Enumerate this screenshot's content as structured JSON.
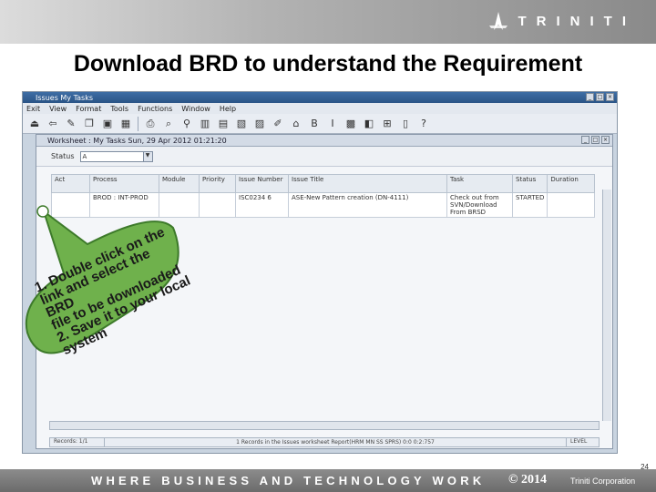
{
  "brand": {
    "logo_text": "TRINITI"
  },
  "slide_title": "Download BRD to understand the Requirement",
  "app": {
    "window_title": "Issues My Tasks",
    "menu": [
      "Exit",
      "View",
      "Format",
      "Tools",
      "Functions",
      "Window",
      "Help"
    ],
    "toolbar_icons": [
      "exit-icon",
      "back-icon",
      "edit-icon",
      "copy-icon",
      "save-icon",
      "save-all-icon",
      "print-icon",
      "find-icon",
      "filter-icon",
      "columns-icon",
      "grid-icon",
      "notes-icon",
      "chart-icon",
      "tools-icon",
      "attachment-icon",
      "bold-icon",
      "italic-icon",
      "image-icon",
      "layout-icon",
      "org-icon",
      "document-icon",
      "help-icon"
    ],
    "inner_window_title": "Worksheet : My Tasks Sun, 29 Apr 2012 01:21:20",
    "status_label": "Status",
    "status_value": "A",
    "columns": [
      "Act",
      "Process",
      "Module",
      "Priority",
      "Issue Number",
      "Issue Title",
      "Task",
      "Status",
      "Duration"
    ],
    "rows": [
      {
        "act": "",
        "process": "BROD : INT-PROD",
        "module": "",
        "priority": "",
        "issue_number": "ISC0234 6",
        "issue_title": "ASE-New Pattern creation (DN-4111)",
        "task": "Check out from SVN/Download From BRSD",
        "status": "STARTED",
        "duration": ""
      }
    ],
    "statusbar_left": "Records: 1/1",
    "statusbar_mid": "1 Records in the Issues worksheet Report(HRM MN SS SPRS) 0:0 0:2:757",
    "statusbar_right": "LEVEL"
  },
  "callout": {
    "lines": [
      "1. Double click on the",
      "link and select the BRD",
      "file to be downloaded",
      "2. Save it to your local",
      "system"
    ]
  },
  "footer": {
    "tagline": "WHERE BUSINESS AND TECHNOLOGY WORK",
    "copyright": "© 2014",
    "company": "Triniti Corporation",
    "page_number": "24"
  }
}
